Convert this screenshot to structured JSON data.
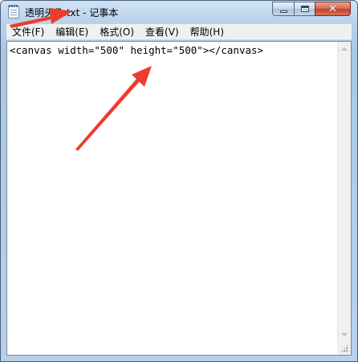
{
  "window": {
    "title": "透明头像.txt - 记事本",
    "icon": "notepad-icon",
    "controls": {
      "minimize_icon": "minimize-icon",
      "maximize_icon": "maximize-icon",
      "close_icon": "close-icon",
      "close_glyph": "✕"
    }
  },
  "menu": {
    "items": [
      {
        "label": "文件(F)"
      },
      {
        "label": "编辑(E)"
      },
      {
        "label": "格式(O)"
      },
      {
        "label": "查看(V)"
      },
      {
        "label": "帮助(H)"
      }
    ]
  },
  "editor": {
    "content": "<canvas width=\"500\" height=\"500\"></canvas>"
  },
  "annotations": {
    "arrow_color": "#ee3b2e"
  },
  "colors": {
    "close_button": "#c8442e",
    "menubar": "#f0f0f0"
  }
}
